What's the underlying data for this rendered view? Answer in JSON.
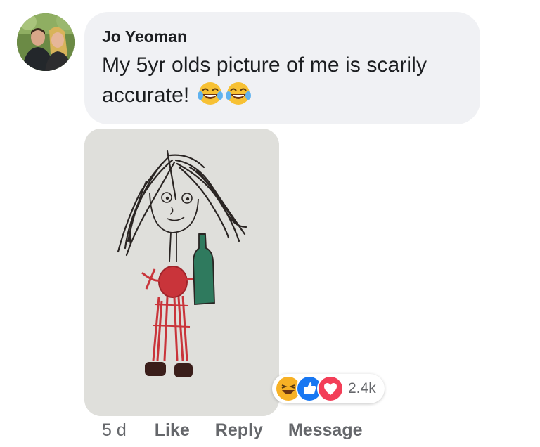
{
  "comment": {
    "author": "Jo Yeoman",
    "text": "My 5yr olds picture of me is scarily accurate!",
    "emojis": [
      "face-with-tears-of-joy-icon",
      "face-with-tears-of-joy-icon"
    ]
  },
  "reactions": {
    "types": [
      "haha-reaction-icon",
      "like-reaction-icon",
      "love-reaction-icon"
    ],
    "count": "2.4k"
  },
  "actions": {
    "time": "5 d",
    "like_label": "Like",
    "reply_label": "Reply",
    "message_label": "Message"
  },
  "colors": {
    "bubble": "#f0f1f4",
    "like_blue": "#1877f2",
    "love_red": "#f33e58",
    "haha_yellow": "#f7b125",
    "secondary_text": "#65676b"
  }
}
